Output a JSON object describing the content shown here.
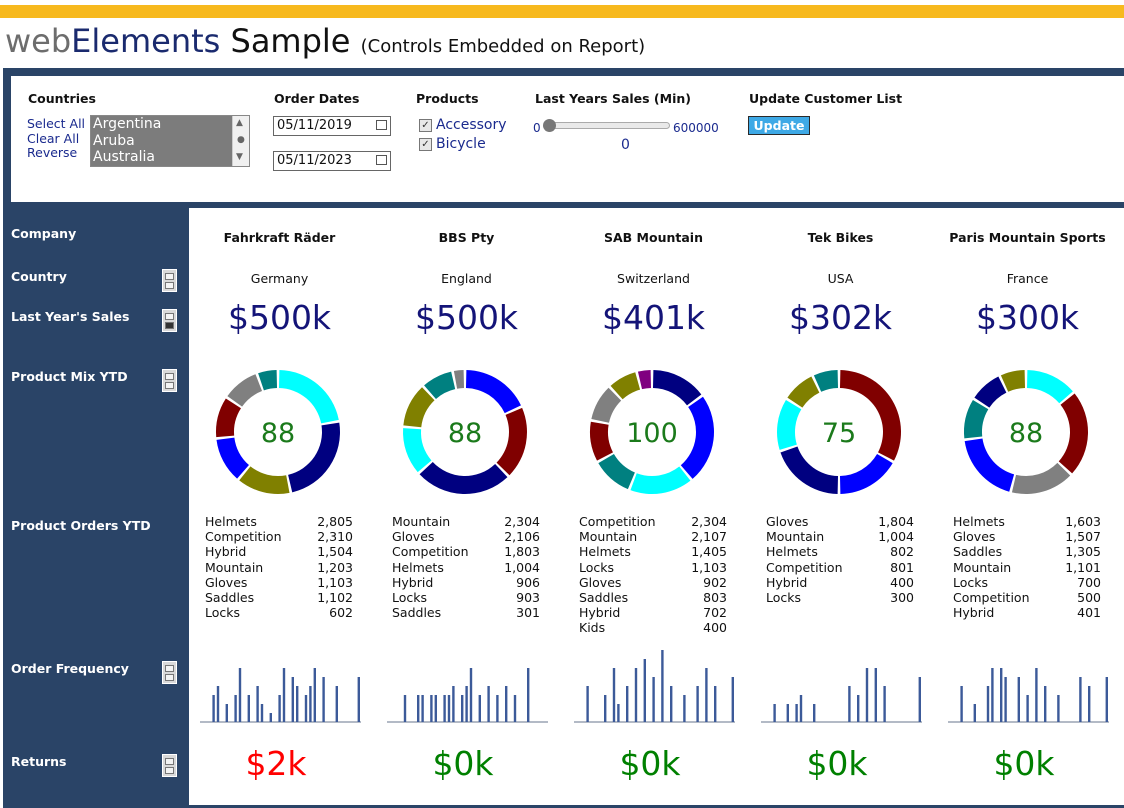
{
  "header": {
    "title_part1": "web",
    "title_part2": "Elements",
    "title_part3": " Sample",
    "subtitle": "(Controls Embedded on Report)",
    "accent_color": "#f7b91e",
    "panel_color": "#2a4467"
  },
  "filters": {
    "countries": {
      "label": "Countries",
      "select_all": "Select All",
      "clear_all": "Clear All",
      "reverse": "Reverse",
      "options": [
        "Argentina",
        "Aruba",
        "Australia"
      ]
    },
    "order_dates": {
      "label": "Order Dates",
      "start": "05/11/2019",
      "end": "05/11/2023"
    },
    "products": {
      "label": "Products",
      "items": [
        "Accessory",
        "Bicycle"
      ]
    },
    "last_years_sales": {
      "label": "Last Years Sales (Min)",
      "min": "0",
      "max": "600000",
      "value": "0"
    },
    "update": {
      "label": "Update Customer List",
      "button": "Update"
    }
  },
  "row_labels": {
    "company": "Company",
    "country": "Country",
    "last_years_sales": "Last Year's Sales",
    "product_mix": "Product Mix YTD",
    "product_orders": "Product Orders YTD",
    "order_frequency": "Order Frequency",
    "returns": "Returns"
  },
  "companies": [
    {
      "name": "Fahrkraft Räder",
      "country": "Germany",
      "sales": "$500k",
      "mix_total": "88",
      "mix": [
        {
          "color": "#00ffff",
          "value": 20
        },
        {
          "color": "#000080",
          "value": 22
        },
        {
          "color": "#808000",
          "value": 13
        },
        {
          "color": "#0000ff",
          "value": 11
        },
        {
          "color": "#800000",
          "value": 10
        },
        {
          "color": "#808080",
          "value": 9
        },
        {
          "color": "#008080",
          "value": 5
        }
      ],
      "orders": [
        {
          "name": "Helmets",
          "value": "2,805"
        },
        {
          "name": "Competition",
          "value": "2,310"
        },
        {
          "name": "Hybrid",
          "value": "1,504"
        },
        {
          "name": "Mountain",
          "value": "1,203"
        },
        {
          "name": "Gloves",
          "value": "1,103"
        },
        {
          "name": "Saddles",
          "value": "1,102"
        },
        {
          "name": "Locks",
          "value": "602"
        }
      ],
      "frequency": [
        0,
        3,
        4,
        0,
        2,
        0,
        3,
        6,
        0,
        3,
        0,
        4,
        2,
        0,
        1,
        0,
        3,
        6,
        0,
        5,
        4,
        0,
        3,
        4,
        6,
        0,
        5,
        0,
        0,
        4,
        0,
        0,
        0,
        0,
        5,
        0
      ],
      "returns": "$2k",
      "returns_color": "#ff0000"
    },
    {
      "name": "BBS Pty",
      "country": "England",
      "sales": "$500k",
      "mix_total": "88",
      "mix": [
        {
          "color": "#0000ff",
          "value": 17
        },
        {
          "color": "#800000",
          "value": 18
        },
        {
          "color": "#000080",
          "value": 24
        },
        {
          "color": "#00ffff",
          "value": 12
        },
        {
          "color": "#808000",
          "value": 11
        },
        {
          "color": "#008080",
          "value": 8
        },
        {
          "color": "#808080",
          "value": 3
        }
      ],
      "orders": [
        {
          "name": "Mountain",
          "value": "2,304"
        },
        {
          "name": "Gloves",
          "value": "2,106"
        },
        {
          "name": "Competition",
          "value": "1,803"
        },
        {
          "name": "Helmets",
          "value": "1,004"
        },
        {
          "name": "Hybrid",
          "value": "906"
        },
        {
          "name": "Locks",
          "value": "903"
        },
        {
          "name": "Saddles",
          "value": "301"
        }
      ],
      "frequency": [
        0,
        0,
        3,
        0,
        0,
        3,
        3,
        0,
        3,
        3,
        0,
        3,
        3,
        4,
        0,
        3,
        4,
        6,
        0,
        3,
        0,
        4,
        0,
        3,
        0,
        4,
        0,
        3,
        0,
        0,
        6,
        0,
        0,
        0,
        0,
        0
      ],
      "returns": "$0k",
      "returns_color": "#008000"
    },
    {
      "name": "SAB Mountain",
      "country": "Switzerland",
      "sales": "$401k",
      "mix_total": "100",
      "mix": [
        {
          "color": "#000080",
          "value": 15
        },
        {
          "color": "#0000ff",
          "value": 24
        },
        {
          "color": "#00ffff",
          "value": 17
        },
        {
          "color": "#008080",
          "value": 11
        },
        {
          "color": "#800000",
          "value": 11
        },
        {
          "color": "#808080",
          "value": 10
        },
        {
          "color": "#808000",
          "value": 8
        },
        {
          "color": "#800080",
          "value": 4
        }
      ],
      "orders": [
        {
          "name": "Competition",
          "value": "2,304"
        },
        {
          "name": "Mountain",
          "value": "2,107"
        },
        {
          "name": "Helmets",
          "value": "1,405"
        },
        {
          "name": "Locks",
          "value": "1,103"
        },
        {
          "name": "Gloves",
          "value": "902"
        },
        {
          "name": "Saddles",
          "value": "803"
        },
        {
          "name": "Hybrid",
          "value": "702"
        },
        {
          "name": "Kids",
          "value": "400"
        }
      ],
      "frequency": [
        0,
        4,
        0,
        0,
        0,
        3,
        0,
        6,
        2,
        0,
        4,
        0,
        6,
        0,
        7,
        0,
        5,
        0,
        8,
        0,
        4,
        0,
        0,
        3,
        0,
        0,
        4,
        0,
        6,
        0,
        4,
        0,
        0,
        0,
        5,
        0
      ],
      "returns": "$0k",
      "returns_color": "#008000"
    },
    {
      "name": "Tek Bikes",
      "country": "USA",
      "sales": "$302k",
      "mix_total": "75",
      "mix": [
        {
          "color": "#800000",
          "value": 33
        },
        {
          "color": "#0000ff",
          "value": 17
        },
        {
          "color": "#000080",
          "value": 20
        },
        {
          "color": "#00ffff",
          "value": 14
        },
        {
          "color": "#808000",
          "value": 9
        },
        {
          "color": "#008080",
          "value": 7
        }
      ],
      "orders": [
        {
          "name": "Gloves",
          "value": "1,804"
        },
        {
          "name": "Mountain",
          "value": "1,004"
        },
        {
          "name": "Helmets",
          "value": "802"
        },
        {
          "name": "Competition",
          "value": "801"
        },
        {
          "name": "Hybrid",
          "value": "400"
        },
        {
          "name": "Locks",
          "value": "300"
        }
      ],
      "frequency": [
        0,
        2,
        0,
        0,
        2,
        0,
        2,
        3,
        0,
        0,
        2,
        0,
        0,
        0,
        0,
        0,
        0,
        0,
        4,
        0,
        3,
        0,
        6,
        0,
        6,
        0,
        4,
        0,
        0,
        0,
        0,
        0,
        0,
        0,
        5,
        0
      ],
      "returns": "$0k",
      "returns_color": "#008000"
    },
    {
      "name": "Paris Mountain Sports",
      "country": "France",
      "sales": "$300k",
      "mix_total": "88",
      "mix": [
        {
          "color": "#00ffff",
          "value": 14
        },
        {
          "color": "#800000",
          "value": 23
        },
        {
          "color": "#808080",
          "value": 17
        },
        {
          "color": "#0000ff",
          "value": 19
        },
        {
          "color": "#008080",
          "value": 11
        },
        {
          "color": "#000080",
          "value": 9
        },
        {
          "color": "#808000",
          "value": 7
        }
      ],
      "orders": [
        {
          "name": "Helmets",
          "value": "1,603"
        },
        {
          "name": "Gloves",
          "value": "1,507"
        },
        {
          "name": "Saddles",
          "value": "1,305"
        },
        {
          "name": "Mountain",
          "value": "1,101"
        },
        {
          "name": "Locks",
          "value": "700"
        },
        {
          "name": "Competition",
          "value": "500"
        },
        {
          "name": "Hybrid",
          "value": "401"
        }
      ],
      "frequency": [
        0,
        4,
        0,
        0,
        2,
        0,
        0,
        4,
        6,
        0,
        6,
        5,
        0,
        0,
        5,
        0,
        3,
        0,
        6,
        0,
        4,
        0,
        0,
        3,
        0,
        0,
        0,
        0,
        5,
        0,
        4,
        0,
        0,
        0,
        5,
        0
      ],
      "returns": "$0k",
      "returns_color": "#008000"
    }
  ]
}
